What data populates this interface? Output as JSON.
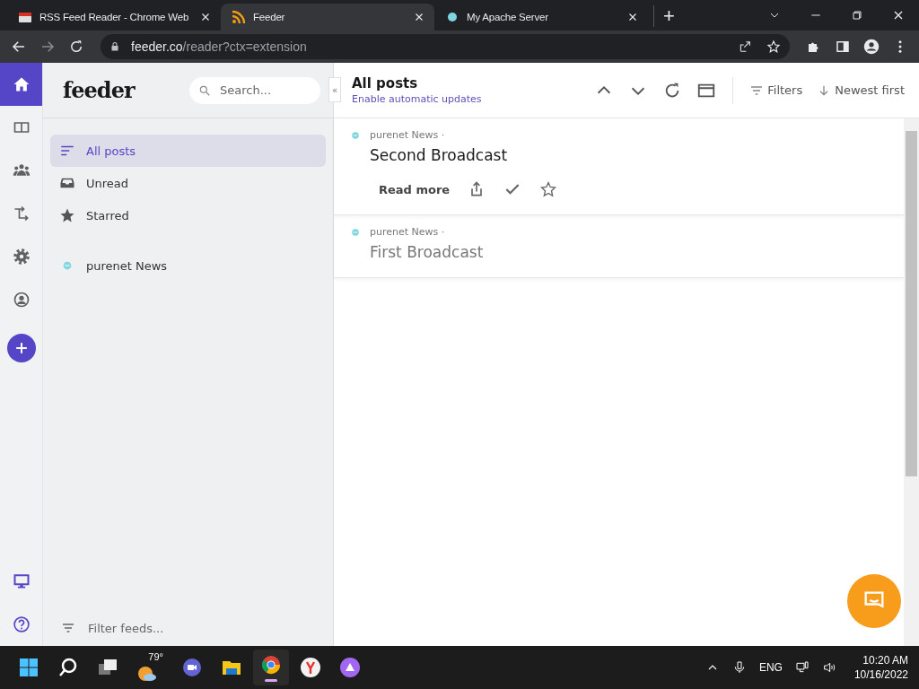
{
  "browser": {
    "tabs": [
      {
        "title": "RSS Feed Reader - Chrome Web",
        "kind": "store",
        "selected": false
      },
      {
        "title": "Feeder",
        "kind": "rss",
        "selected": true
      },
      {
        "title": "My Apache Server",
        "kind": "dot",
        "selected": false
      }
    ],
    "new_tab": "+",
    "url_host": "feeder.co",
    "url_path": "/reader?ctx=extension"
  },
  "rail": {
    "items": [
      {
        "kind": "home",
        "selected": true
      },
      {
        "kind": "columns",
        "selected": false
      },
      {
        "kind": "people",
        "selected": false
      },
      {
        "kind": "route",
        "selected": false
      },
      {
        "kind": "gear",
        "selected": false
      },
      {
        "kind": "user",
        "selected": false
      }
    ],
    "bottom": [
      {
        "kind": "monitor"
      },
      {
        "kind": "help"
      }
    ]
  },
  "sidebar": {
    "logo": "feeder",
    "search_placeholder": "Search...",
    "collapse": "«",
    "nav": [
      {
        "label": "All posts",
        "kind": "list",
        "selected": true
      },
      {
        "label": "Unread",
        "kind": "inbox",
        "selected": false
      },
      {
        "label": "Starred",
        "kind": "star",
        "selected": false
      }
    ],
    "feeds": [
      {
        "label": "purenet News"
      }
    ],
    "filter_placeholder": "Filter feeds..."
  },
  "main": {
    "title": "All posts",
    "subtitle": "Enable automatic updates",
    "filters": "Filters",
    "sort": "Newest first",
    "posts": [
      {
        "feed": "purenet News ·",
        "title": "Second Broadcast",
        "read": false,
        "read_more": "Read more"
      },
      {
        "feed": "purenet News ·",
        "title": "First Broadcast",
        "read": true
      }
    ]
  },
  "taskbar": {
    "weather": "79°",
    "language": "ENG",
    "time": "10:20 AM",
    "date": "10/16/2022"
  }
}
